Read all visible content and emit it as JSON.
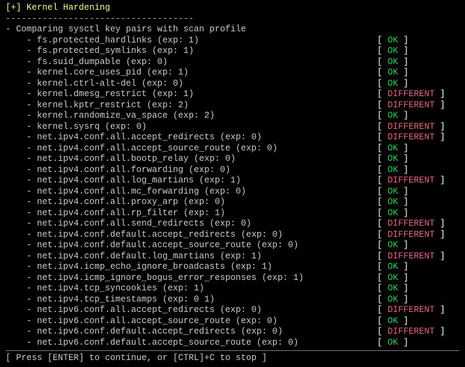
{
  "header": {
    "title": "[+] Kernel Hardening",
    "dashes": "------------------------------------",
    "subtitle": "  - Comparing sysctl key pairs with scan profile"
  },
  "statusLabels": {
    "ok": "OK",
    "diff": "DIFFERENT"
  },
  "rows": [
    {
      "key": "fs.protected_hardlinks (exp: 1)",
      "status": "ok"
    },
    {
      "key": "fs.protected_symlinks (exp: 1)",
      "status": "ok"
    },
    {
      "key": "fs.suid_dumpable (exp: 0)",
      "status": "ok"
    },
    {
      "key": "kernel.core_uses_pid (exp: 1)",
      "status": "ok"
    },
    {
      "key": "kernel.ctrl-alt-del (exp: 0)",
      "status": "ok"
    },
    {
      "key": "kernel.dmesg_restrict (exp: 1)",
      "status": "diff"
    },
    {
      "key": "kernel.kptr_restrict (exp: 2)",
      "status": "diff"
    },
    {
      "key": "kernel.randomize_va_space (exp: 2)",
      "status": "ok"
    },
    {
      "key": "kernel.sysrq (exp: 0)",
      "status": "diff"
    },
    {
      "key": "net.ipv4.conf.all.accept_redirects (exp: 0)",
      "status": "diff"
    },
    {
      "key": "net.ipv4.conf.all.accept_source_route (exp: 0)",
      "status": "ok"
    },
    {
      "key": "net.ipv4.conf.all.bootp_relay (exp: 0)",
      "status": "ok"
    },
    {
      "key": "net.ipv4.conf.all.forwarding (exp: 0)",
      "status": "ok"
    },
    {
      "key": "net.ipv4.conf.all.log_martians (exp: 1)",
      "status": "diff"
    },
    {
      "key": "net.ipv4.conf.all.mc_forwarding (exp: 0)",
      "status": "ok"
    },
    {
      "key": "net.ipv4.conf.all.proxy_arp (exp: 0)",
      "status": "ok"
    },
    {
      "key": "net.ipv4.conf.all.rp_filter (exp: 1)",
      "status": "ok"
    },
    {
      "key": "net.ipv4.conf.all.send_redirects (exp: 0)",
      "status": "diff"
    },
    {
      "key": "net.ipv4.conf.default.accept_redirects (exp: 0)",
      "status": "diff"
    },
    {
      "key": "net.ipv4.conf.default.accept_source_route (exp: 0)",
      "status": "ok"
    },
    {
      "key": "net.ipv4.conf.default.log_martians (exp: 1)",
      "status": "diff"
    },
    {
      "key": "net.ipv4.icmp_echo_ignore_broadcasts (exp: 1)",
      "status": "ok"
    },
    {
      "key": "net.ipv4.icmp_ignore_bogus_error_responses (exp: 1)",
      "status": "ok"
    },
    {
      "key": "net.ipv4.tcp_syncookies (exp: 1)",
      "status": "ok"
    },
    {
      "key": "net.ipv4.tcp_timestamps (exp: 0 1)",
      "status": "ok"
    },
    {
      "key": "net.ipv6.conf.all.accept_redirects (exp: 0)",
      "status": "diff"
    },
    {
      "key": "net.ipv6.conf.all.accept_source_route (exp: 0)",
      "status": "ok"
    },
    {
      "key": "net.ipv6.conf.default.accept_redirects (exp: 0)",
      "status": "diff"
    },
    {
      "key": "net.ipv6.conf.default.accept_source_route (exp: 0)",
      "status": "ok"
    }
  ],
  "footer": "[ Press [ENTER] to continue, or [CTRL]+C to stop ]"
}
